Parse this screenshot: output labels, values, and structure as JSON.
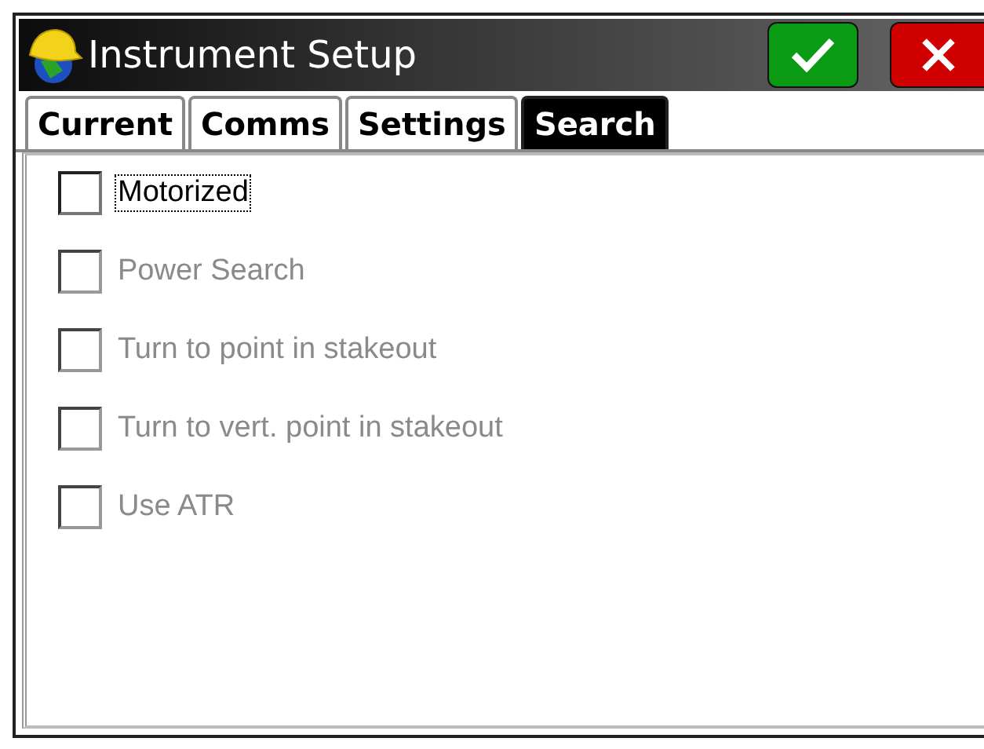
{
  "window": {
    "title": "Instrument Setup"
  },
  "tabs": [
    {
      "label": "Current",
      "selected": false
    },
    {
      "label": "Comms",
      "selected": false
    },
    {
      "label": "Settings",
      "selected": false
    },
    {
      "label": "Search",
      "selected": true
    }
  ],
  "options": [
    {
      "label": "Motorized",
      "checked": false,
      "disabled": false,
      "focused": true
    },
    {
      "label": "Power Search",
      "checked": false,
      "disabled": true,
      "focused": false
    },
    {
      "label": "Turn to point in stakeout",
      "checked": false,
      "disabled": true,
      "focused": false
    },
    {
      "label": "Turn to vert. point in stakeout",
      "checked": false,
      "disabled": true,
      "focused": false
    },
    {
      "label": "Use ATR",
      "checked": false,
      "disabled": true,
      "focused": false
    }
  ]
}
